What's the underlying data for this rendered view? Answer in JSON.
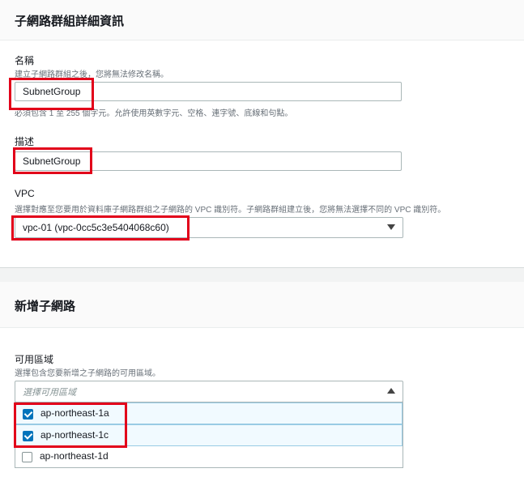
{
  "details_panel": {
    "title": "子網路群組詳細資訊",
    "name": {
      "label": "名稱",
      "description": "建立子網路群組之後，您將無法修改名稱。",
      "value": "SubnetGroup",
      "constraint": "必須包含 1 至 255 個字元。允許使用英數字元、空格、連字號、底線和句點。"
    },
    "description": {
      "label": "描述",
      "value": "SubnetGroup"
    },
    "vpc": {
      "label": "VPC",
      "description": "選擇對應至您要用於資料庫子網路群組之子網路的 VPC 識別符。子網路群組建立後，您將無法選擇不同的 VPC 識別符。",
      "value": "vpc-01 (vpc-0cc5c3e5404068c60)"
    }
  },
  "subnets_panel": {
    "title": "新增子網路",
    "az": {
      "label": "可用區域",
      "description": "選擇包含您要新增之子網路的可用區域。",
      "placeholder": "選擇可用區域",
      "options": [
        {
          "label": "ap-northeast-1a",
          "checked": true
        },
        {
          "label": "ap-northeast-1c",
          "checked": true
        },
        {
          "label": "ap-northeast-1d",
          "checked": false
        }
      ]
    }
  },
  "colors": {
    "highlight": "#e2001a",
    "checkbox": "#0073bb"
  }
}
